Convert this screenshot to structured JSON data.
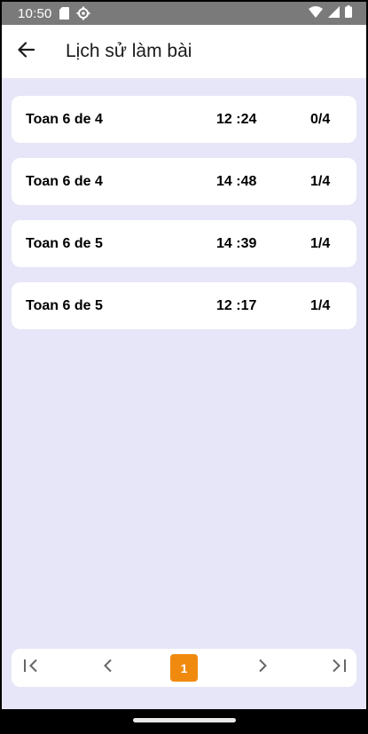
{
  "status_bar": {
    "time": "10:50",
    "left_icons": [
      "sd-card-icon",
      "settings-gear-icon"
    ],
    "right_icons": [
      "wifi-icon",
      "signal-icon",
      "battery-icon"
    ]
  },
  "app_bar": {
    "title": "Lịch sử làm bài",
    "back_icon": "arrow-left-icon"
  },
  "history": [
    {
      "name": "Toan 6 de 4",
      "time": "12 :24",
      "score": "0/4"
    },
    {
      "name": "Toan 6 de 4",
      "time": "14 :48",
      "score": "1/4"
    },
    {
      "name": "Toan 6 de 5",
      "time": "14 :39",
      "score": "1/4"
    },
    {
      "name": "Toan 6 de 5",
      "time": "12 :17",
      "score": "1/4"
    }
  ],
  "pagination": {
    "current_page": "1",
    "icons": [
      "first-page-icon",
      "previous-page-icon",
      "next-page-icon",
      "last-page-icon"
    ],
    "accent_color": "#f08a0f"
  },
  "colors": {
    "background": "#e6e6f8",
    "card": "#ffffff",
    "status_bar": "#7a7a7a"
  }
}
